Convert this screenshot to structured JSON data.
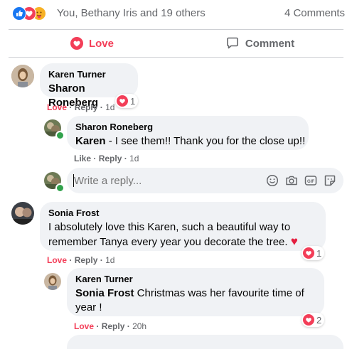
{
  "summary": {
    "reactors_text": "You, Bethany Iris and 19 others",
    "comments_text": "4 Comments",
    "reaction_colors": {
      "like": "#1877f2",
      "love": "#f33e58",
      "care": "#f7b125"
    }
  },
  "actions": {
    "love_label": "Love",
    "comment_label": "Comment",
    "love_color": "#f33e58"
  },
  "comments": [
    {
      "author": "Karen Turner",
      "mention": "Sharon Roneberg",
      "text": "",
      "reaction_label": "Love",
      "reply_label": "Reply",
      "time": "1d",
      "reaction_count": "1"
    },
    {
      "author": "Sharon Roneberg",
      "mention": "Karen",
      "text": " - I see them!! Thank you for the close up!!",
      "reaction_label": "Like",
      "reply_label": "Reply",
      "time": "1d"
    },
    {
      "author": "Sonia Frost",
      "text_line1": "I absolutely love this Karen, such a beautiful way to",
      "text_line2": "remember Tanya every year you decorate the tree.",
      "emoji": "♥",
      "reaction_label": "Love",
      "reply_label": "Reply",
      "time": "1d",
      "reaction_count": "1"
    },
    {
      "author": "Karen Turner",
      "mention": "Sonia Frost",
      "text_line1": " Christmas was her favourite time of",
      "text_line2": "year !",
      "reaction_label": "Love",
      "reply_label": "Reply",
      "time": "20h",
      "reaction_count": "2"
    }
  ],
  "reply_input": {
    "placeholder": "Write a reply...",
    "icons": [
      "emoji-icon",
      "camera-icon",
      "gif-icon",
      "sticker-icon"
    ]
  }
}
